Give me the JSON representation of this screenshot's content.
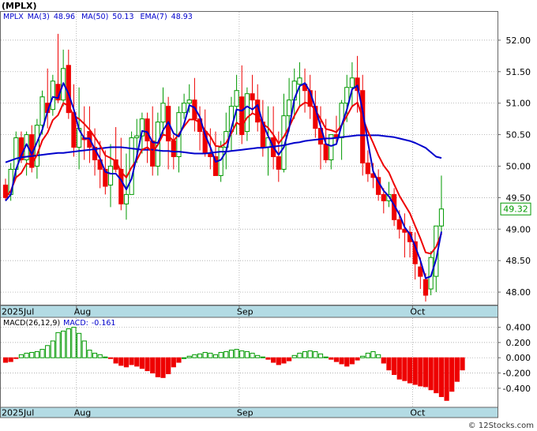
{
  "header": {
    "ticker": "(MPLX)",
    "price_legend": [
      {
        "label": "MPLX",
        "value": "",
        "color": "#0000cc"
      },
      {
        "label": "MA(3)",
        "value": "48.96",
        "color": "#0000cc"
      },
      {
        "label": "MA(50)",
        "value": "50.13",
        "color": "#0000cc"
      },
      {
        "label": "EMA(7)",
        "value": "48.93",
        "color": "#0000cc"
      }
    ],
    "macd_legend": [
      {
        "label": "MACD(26,12,9)",
        "value": "",
        "color": "#000000"
      },
      {
        "label": "MACD:",
        "value": "-0.161",
        "color": "#0000cc"
      }
    ],
    "last_price_tag": "49.32",
    "credit": "© 12Stocks.com"
  },
  "colors": {
    "up": "#009900",
    "down": "#ee0000",
    "ma_short": "#0000cc",
    "ma_long": "#0000cc",
    "ema": "#ee0000",
    "axis_band": "#b3dbe4",
    "grid": "#999999"
  },
  "chart_data": [
    {
      "type": "candlestick",
      "title": "(MPLX)",
      "ylim": [
        47.8,
        52.45
      ],
      "yticks": [
        "48.00",
        "48.50",
        "49.00",
        "49.50",
        "50.00",
        "50.50",
        "51.00",
        "51.50",
        "52.00"
      ],
      "x_tick_labels": [
        {
          "label": "2025Jul",
          "index": 0
        },
        {
          "label": "Aug",
          "index": 14
        },
        {
          "label": "Sep",
          "index": 45
        },
        {
          "label": "Oct",
          "index": 78
        }
      ],
      "grid": true,
      "ohlc": [
        [
          49.7,
          49.8,
          49.45,
          49.5
        ],
        [
          49.55,
          50.05,
          49.45,
          49.95
        ],
        [
          49.95,
          50.55,
          49.8,
          50.45
        ],
        [
          50.45,
          50.55,
          50.05,
          50.1
        ],
        [
          50.1,
          50.55,
          49.85,
          50.5
        ],
        [
          50.5,
          50.65,
          49.9,
          49.98
        ],
        [
          50.0,
          50.75,
          49.8,
          50.65
        ],
        [
          50.65,
          51.2,
          50.5,
          51.1
        ],
        [
          51.0,
          51.55,
          50.6,
          50.85
        ],
        [
          50.9,
          51.45,
          50.8,
          51.35
        ],
        [
          51.3,
          52.1,
          51.0,
          51.05
        ],
        [
          51.05,
          51.85,
          50.95,
          51.55
        ],
        [
          51.6,
          51.85,
          50.75,
          50.85
        ],
        [
          50.85,
          51.3,
          50.15,
          50.3
        ],
        [
          50.3,
          51.25,
          49.95,
          50.6
        ],
        [
          50.45,
          50.95,
          50.1,
          50.42
        ],
        [
          50.55,
          50.95,
          50.05,
          50.3
        ],
        [
          50.3,
          50.6,
          49.85,
          50.1
        ],
        [
          50.1,
          50.4,
          49.65,
          49.95
        ],
        [
          49.95,
          50.25,
          49.55,
          49.68
        ],
        [
          49.7,
          50.35,
          49.35,
          50.0
        ],
        [
          50.1,
          50.62,
          49.9,
          49.95
        ],
        [
          49.95,
          50.45,
          49.3,
          49.4
        ],
        [
          49.4,
          50.2,
          49.15,
          49.55
        ],
        [
          49.55,
          50.55,
          49.55,
          50.45
        ],
        [
          50.45,
          50.75,
          50.05,
          50.48
        ],
        [
          50.48,
          50.85,
          50.2,
          50.75
        ],
        [
          50.75,
          50.85,
          50.05,
          50.4
        ],
        [
          50.4,
          50.95,
          49.85,
          50.0
        ],
        [
          50.0,
          50.85,
          49.85,
          50.7
        ],
        [
          50.7,
          51.25,
          50.5,
          51.0
        ],
        [
          50.95,
          51.1,
          49.95,
          50.4
        ],
        [
          50.4,
          50.5,
          49.95,
          50.15
        ],
        [
          50.15,
          50.95,
          49.9,
          50.85
        ],
        [
          50.85,
          51.15,
          50.75,
          51.0
        ],
        [
          51.0,
          51.3,
          50.85,
          51.05
        ],
        [
          51.05,
          51.4,
          50.55,
          50.75
        ],
        [
          50.75,
          50.95,
          50.25,
          50.55
        ],
        [
          50.55,
          50.9,
          50.15,
          50.2
        ],
        [
          50.2,
          50.6,
          49.95,
          50.15
        ],
        [
          50.15,
          50.55,
          49.85,
          49.85
        ],
        [
          49.85,
          50.4,
          49.75,
          50.3
        ],
        [
          50.3,
          50.85,
          49.95,
          50.55
        ],
        [
          50.55,
          51.1,
          50.25,
          50.95
        ],
        [
          50.95,
          51.45,
          50.5,
          51.2
        ],
        [
          51.1,
          51.6,
          50.35,
          50.5
        ],
        [
          50.55,
          51.25,
          50.4,
          51.15
        ],
        [
          51.15,
          51.45,
          50.85,
          51.05
        ],
        [
          51.05,
          51.3,
          50.55,
          50.7
        ],
        [
          50.7,
          51.05,
          50.15,
          50.3
        ],
        [
          50.3,
          50.95,
          49.85,
          50.45
        ],
        [
          50.45,
          50.95,
          49.95,
          50.15
        ],
        [
          50.15,
          50.55,
          49.75,
          49.95
        ],
        [
          49.95,
          51.15,
          49.9,
          50.8
        ],
        [
          50.8,
          51.4,
          50.55,
          51.05
        ],
        [
          51.05,
          51.55,
          50.75,
          51.35
        ],
        [
          51.3,
          51.65,
          50.95,
          51.4
        ],
        [
          51.3,
          51.55,
          50.85,
          51.2
        ],
        [
          51.2,
          51.45,
          50.75,
          50.95
        ],
        [
          50.95,
          51.2,
          50.45,
          50.6
        ],
        [
          50.6,
          50.95,
          49.95,
          50.35
        ],
        [
          50.35,
          50.75,
          50.05,
          50.1
        ],
        [
          50.1,
          50.45,
          49.95,
          50.5
        ],
        [
          50.5,
          50.8,
          50.35,
          50.45
        ],
        [
          50.45,
          51.05,
          50.1,
          51.0
        ],
        [
          51.0,
          51.45,
          50.7,
          51.25
        ],
        [
          51.25,
          51.65,
          50.95,
          51.4
        ],
        [
          51.4,
          51.75,
          50.85,
          51.2
        ],
        [
          51.2,
          51.45,
          49.85,
          50.05
        ],
        [
          50.05,
          50.25,
          49.75,
          49.88
        ],
        [
          49.88,
          50.05,
          49.65,
          49.82
        ],
        [
          49.82,
          49.95,
          49.45,
          49.55
        ],
        [
          49.55,
          49.65,
          49.25,
          49.45
        ],
        [
          49.45,
          49.75,
          49.35,
          49.55
        ],
        [
          49.55,
          49.65,
          49.05,
          49.15
        ],
        [
          49.15,
          49.3,
          48.85,
          49.0
        ],
        [
          49.0,
          49.25,
          48.55,
          48.95
        ],
        [
          48.95,
          49.05,
          48.55,
          48.8
        ],
        [
          48.8,
          48.95,
          48.2,
          48.45
        ],
        [
          48.4,
          48.55,
          48.05,
          48.25
        ],
        [
          48.2,
          48.3,
          47.85,
          47.95
        ],
        [
          48.05,
          48.65,
          47.95,
          48.55
        ],
        [
          48.25,
          49.05,
          48.0,
          49.05
        ],
        [
          49.05,
          49.85,
          48.95,
          49.32
        ]
      ],
      "series": [
        {
          "name": "MA(3)",
          "color": "#0000cc",
          "values": [
            49.45,
            49.55,
            49.95,
            50.17,
            50.35,
            50.19,
            50.38,
            50.58,
            50.87,
            51.1,
            51.08,
            51.32,
            51.15,
            50.9,
            50.58,
            50.44,
            50.44,
            50.27,
            50.12,
            49.91,
            49.88,
            49.88,
            49.78,
            49.63,
            49.8,
            50.16,
            50.56,
            50.54,
            50.38,
            50.37,
            50.57,
            50.7,
            50.52,
            50.47,
            50.67,
            50.97,
            50.93,
            50.78,
            50.5,
            50.3,
            50.07,
            50.1,
            50.23,
            50.6,
            50.9,
            50.88,
            50.95,
            50.9,
            50.97,
            50.68,
            50.48,
            50.3,
            50.18,
            50.3,
            50.6,
            51.07,
            51.27,
            51.32,
            51.18,
            50.92,
            50.63,
            50.35,
            50.32,
            50.35,
            50.65,
            50.9,
            51.22,
            51.28,
            50.88,
            50.38,
            49.92,
            49.75,
            49.61,
            49.52,
            49.38,
            49.23,
            49.03,
            48.92,
            48.73,
            48.5,
            48.22,
            48.25,
            48.52,
            48.96
          ]
        },
        {
          "name": "MA(50)",
          "color": "#0000cc",
          "values": [
            50.06,
            50.09,
            50.12,
            50.14,
            50.15,
            50.16,
            50.17,
            50.18,
            50.19,
            50.2,
            50.21,
            50.21,
            50.22,
            50.23,
            50.24,
            50.25,
            50.26,
            50.27,
            50.28,
            50.29,
            50.3,
            50.3,
            50.3,
            50.29,
            50.28,
            50.27,
            50.26,
            50.26,
            50.26,
            50.25,
            50.24,
            50.24,
            50.23,
            50.23,
            50.22,
            50.21,
            50.2,
            50.2,
            50.2,
            50.21,
            50.22,
            50.23,
            50.23,
            50.24,
            50.25,
            50.26,
            50.27,
            50.28,
            50.29,
            50.29,
            50.3,
            50.31,
            50.32,
            50.33,
            50.35,
            50.37,
            50.38,
            50.4,
            50.41,
            50.42,
            50.43,
            50.44,
            50.44,
            50.45,
            50.46,
            50.47,
            50.48,
            50.49,
            50.49,
            50.49,
            50.49,
            50.49,
            50.48,
            50.47,
            50.46,
            50.44,
            50.42,
            50.4,
            50.37,
            50.33,
            50.29,
            50.22,
            50.15,
            50.13
          ]
        },
        {
          "name": "EMA(7)",
          "color": "#ee0000",
          "values": [
            49.5,
            49.61,
            49.82,
            49.89,
            50.04,
            50.03,
            50.18,
            50.41,
            50.53,
            50.73,
            50.81,
            51.0,
            50.96,
            50.8,
            50.75,
            50.67,
            50.58,
            50.46,
            50.33,
            50.17,
            50.13,
            50.08,
            49.91,
            49.82,
            49.98,
            50.1,
            50.26,
            50.3,
            50.22,
            50.34,
            50.5,
            50.48,
            50.4,
            50.51,
            50.63,
            50.74,
            50.74,
            50.69,
            50.57,
            50.47,
            50.32,
            50.31,
            50.37,
            50.52,
            50.69,
            50.64,
            50.77,
            50.84,
            50.8,
            50.67,
            50.61,
            50.5,
            50.36,
            50.47,
            50.62,
            50.8,
            50.95,
            51.01,
            50.99,
            50.89,
            50.75,
            50.59,
            50.57,
            50.54,
            50.65,
            50.8,
            50.95,
            51.01,
            50.77,
            50.55,
            50.37,
            50.17,
            50.01,
            49.9,
            49.71,
            49.53,
            49.39,
            49.25,
            49.05,
            48.85,
            48.63,
            48.61,
            48.72,
            48.93
          ]
        }
      ]
    },
    {
      "type": "bar",
      "title": "MACD(26,12,9)",
      "ylim": [
        -0.64,
        0.52
      ],
      "yticks": [
        "0.400",
        "0.200",
        "0.000",
        "-0.200",
        "-0.400"
      ],
      "x_tick_labels": [
        {
          "label": "2025Jul",
          "index": 0
        },
        {
          "label": "Aug",
          "index": 14
        },
        {
          "label": "Sep",
          "index": 45
        },
        {
          "label": "Oct",
          "index": 78
        }
      ],
      "values": [
        -0.06,
        -0.05,
        -0.01,
        0.04,
        0.06,
        0.07,
        0.08,
        0.11,
        0.16,
        0.22,
        0.33,
        0.35,
        0.38,
        0.4,
        0.32,
        0.22,
        0.1,
        0.06,
        0.04,
        0.01,
        -0.01,
        -0.07,
        -0.1,
        -0.12,
        -0.09,
        -0.11,
        -0.14,
        -0.17,
        -0.2,
        -0.25,
        -0.26,
        -0.21,
        -0.12,
        -0.06,
        0.0,
        0.02,
        0.04,
        0.05,
        0.07,
        0.06,
        0.04,
        0.07,
        0.08,
        0.1,
        0.11,
        0.09,
        0.08,
        0.06,
        0.03,
        0.01,
        -0.02,
        -0.06,
        -0.09,
        -0.07,
        -0.04,
        0.03,
        0.06,
        0.08,
        0.09,
        0.08,
        0.05,
        0.01,
        -0.02,
        -0.05,
        -0.08,
        -0.11,
        -0.08,
        -0.03,
        0.02,
        0.06,
        0.08,
        0.04,
        -0.07,
        -0.16,
        -0.22,
        -0.28,
        -0.3,
        -0.33,
        -0.35,
        -0.37,
        -0.38,
        -0.42,
        -0.46,
        -0.51,
        -0.56,
        -0.44,
        -0.31,
        -0.16
      ],
      "series": [
        {
          "name": "MACD:",
          "values": []
        }
      ]
    }
  ]
}
